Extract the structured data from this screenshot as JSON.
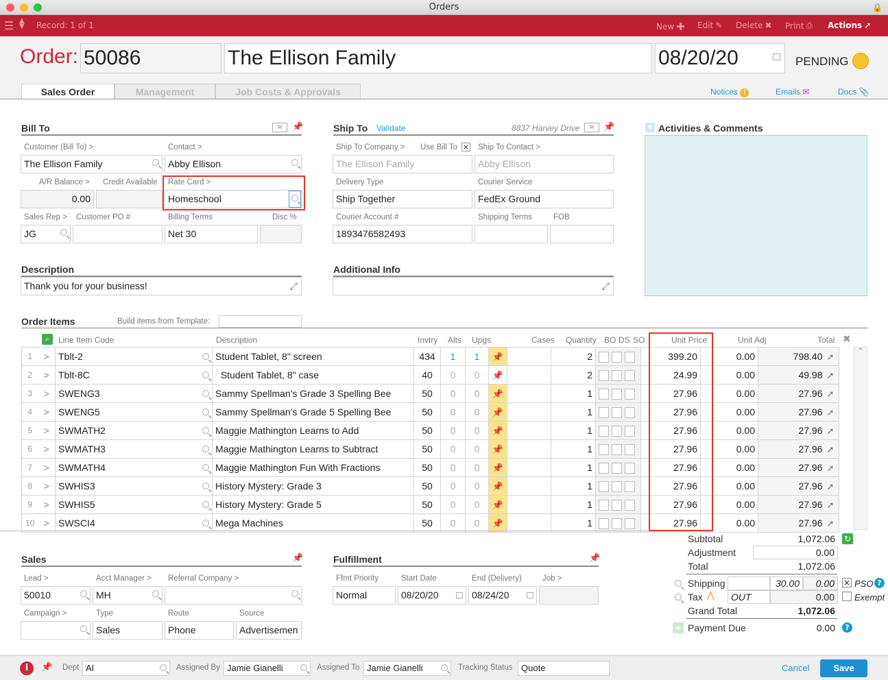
{
  "window": {
    "title": "Orders"
  },
  "toolbar": {
    "record": "Record: 1 of 1",
    "new": "New",
    "edit": "Edit",
    "delete": "Delete",
    "print": "Print",
    "actions": "Actions"
  },
  "header": {
    "order_label": "Order:",
    "order_number": "50086",
    "customer_name": "The Ellison Family",
    "date": "08/20/20",
    "status": "PENDING",
    "status_color": "#f6c32c"
  },
  "tabs": [
    {
      "label": "Sales Order"
    },
    {
      "label": "Management"
    },
    {
      "label": "Job Costs & Approvals"
    }
  ],
  "tab_links": {
    "notices": "Notices",
    "emails": "Emails",
    "docs": "Docs"
  },
  "bill_to": {
    "title": "Bill To",
    "customer_label": "Customer (Bill To) >",
    "customer": "The Ellison Family",
    "contact_label": "Contact >",
    "contact": "Abby Ellison",
    "ar_label": "A/R Balance >",
    "ar": "0.00",
    "credit_label": "Credit Available",
    "credit": "",
    "rate_card_label": "Rate Card >",
    "rate_card": "Homeschool",
    "sales_rep_label": "Sales Rep >",
    "sales_rep": "JG",
    "po_label": "Customer PO #",
    "po": "",
    "billing_terms_label": "Billing Terms",
    "billing_terms": "Net 30",
    "disc_label": "Disc %",
    "disc": ""
  },
  "ship_to": {
    "title": "Ship To",
    "validate": "Validate",
    "address": "8837 Harvey Drive",
    "company_label": "Ship To Company >",
    "use_bill_to_label": "Use Bill To",
    "use_bill_to_checked": "×",
    "company": "The Ellison Family",
    "contact_label": "Ship To Contact >",
    "contact": "Abby Ellison",
    "delivery_label": "Delivery Type",
    "delivery": "Ship Together",
    "courier_label": "Courier Service",
    "courier": "FedEx Ground",
    "account_label": "Courier Account #",
    "account": "1893476582493",
    "terms_label": "Shipping Terms",
    "terms": "",
    "fob_label": "FOB",
    "fob": ""
  },
  "activities": {
    "title": "Activities & Comments"
  },
  "description": {
    "title": "Description",
    "value": "Thank you for your business!"
  },
  "additional": {
    "title": "Additional Info",
    "value": ""
  },
  "order_items": {
    "title": "Order Items",
    "template_label": "Build items from Template:",
    "template_value": "",
    "headers": {
      "code": "Line Item Code",
      "desc": "Description",
      "invtry": "Invtry",
      "alts": "Alts",
      "upgs": "Upgs",
      "cases": "Cases",
      "qty": "Quantity",
      "bo": "BO",
      "ds": "DS",
      "so": "SO",
      "price": "Unit Price",
      "adj": "Unit Adj",
      "total": "Total"
    },
    "rows": [
      {
        "n": "1",
        "code": "Tblt-2",
        "desc": "Student Tablet, 8\" screen",
        "inv": "434",
        "alts": "1",
        "upgs": "1",
        "cases": "",
        "qty": "2",
        "price": "399.20",
        "adj": "0.00",
        "total": "798.40"
      },
      {
        "n": "2",
        "code": "Tblt-8C",
        "desc": "  Student Tablet, 8\" case",
        "inv": "40",
        "alts": "0",
        "upgs": "0",
        "cases": "",
        "qty": "2",
        "price": "24.99",
        "adj": "0.00",
        "total": "49.98"
      },
      {
        "n": "3",
        "code": "SWENG3",
        "desc": "Sammy Spellman's Grade 3 Spelling Bee",
        "inv": "50",
        "alts": "0",
        "upgs": "0",
        "cases": "",
        "qty": "1",
        "price": "27.96",
        "adj": "0.00",
        "total": "27.96"
      },
      {
        "n": "4",
        "code": "SWENG5",
        "desc": "Sammy Spellman's Grade 5 Spelling Bee",
        "inv": "50",
        "alts": "0",
        "upgs": "0",
        "cases": "",
        "qty": "1",
        "price": "27.96",
        "adj": "0.00",
        "total": "27.96"
      },
      {
        "n": "5",
        "code": "SWMATH2",
        "desc": "Maggie Mathington Learns to Add",
        "inv": "50",
        "alts": "0",
        "upgs": "0",
        "cases": "",
        "qty": "1",
        "price": "27.96",
        "adj": "0.00",
        "total": "27.96"
      },
      {
        "n": "6",
        "code": "SWMATH3",
        "desc": "Maggie Mathington Learns to Subtract",
        "inv": "50",
        "alts": "0",
        "upgs": "0",
        "cases": "",
        "qty": "1",
        "price": "27.96",
        "adj": "0.00",
        "total": "27.96"
      },
      {
        "n": "7",
        "code": "SWMATH4",
        "desc": "Maggie Mathington Fun With Fractions",
        "inv": "50",
        "alts": "0",
        "upgs": "0",
        "cases": "",
        "qty": "1",
        "price": "27.96",
        "adj": "0.00",
        "total": "27.96"
      },
      {
        "n": "8",
        "code": "SWHIS3",
        "desc": "History Mystery: Grade 3",
        "inv": "50",
        "alts": "0",
        "upgs": "0",
        "cases": "",
        "qty": "1",
        "price": "27.96",
        "adj": "0.00",
        "total": "27.96"
      },
      {
        "n": "9",
        "code": "SWHIS5",
        "desc": "History Mystery: Grade 5",
        "inv": "50",
        "alts": "0",
        "upgs": "0",
        "cases": "",
        "qty": "1",
        "price": "27.96",
        "adj": "0.00",
        "total": "27.96"
      },
      {
        "n": "10",
        "code": "SWSCI4",
        "desc": "Mega Machines",
        "inv": "50",
        "alts": "0",
        "upgs": "0",
        "cases": "",
        "qty": "1",
        "price": "27.96",
        "adj": "0.00",
        "total": "27.96"
      }
    ]
  },
  "sales": {
    "title": "Sales",
    "lead_label": "Lead >",
    "lead": "50010",
    "acct_label": "Acct Manager >",
    "acct": "MH",
    "referral_label": "Referral Company >",
    "referral": "",
    "campaign_label": "Campaign >",
    "campaign": "",
    "type_label": "Type",
    "type": "Sales",
    "route_label": "Route",
    "route": "Phone",
    "source_label": "Source",
    "source": "Advertisemen"
  },
  "fulfillment": {
    "title": "Fulfillment",
    "priority_label": "Ffmt Priority",
    "priority": "Normal",
    "start_label": "Start Date",
    "start": "08/20/20",
    "end_label": "End (Delivery)",
    "end": "08/24/20",
    "job_label": "Job >",
    "job": ""
  },
  "totals": {
    "subtotal_label": "Subtotal",
    "subtotal": "1,072.06",
    "adjustment_label": "Adjustment",
    "adjustment": "0.00",
    "total_label": "Total",
    "total": "1,072.06",
    "shipping_label": "Shipping",
    "shipping_a": "30.00",
    "shipping_b": "0.00",
    "pso_checked": "×",
    "pso_label": "PSO",
    "tax_label": "Tax",
    "tax_code": "OUT",
    "tax": "0.00",
    "exempt_label": "Exempt",
    "grand_label": "Grand Total",
    "grand": "1,072.06",
    "payment_label": "Payment Due",
    "payment": "0.00"
  },
  "footer": {
    "dept_label": "Dept",
    "dept": "AI",
    "assigned_by_label": "Assigned By",
    "assigned_by": "Jamie Gianelli",
    "assigned_to_label": "Assigned To",
    "assigned_to": "Jamie Gianelli",
    "tracking_label": "Tracking Status",
    "tracking": "Quote",
    "cancel": "Cancel",
    "save": "Save"
  }
}
